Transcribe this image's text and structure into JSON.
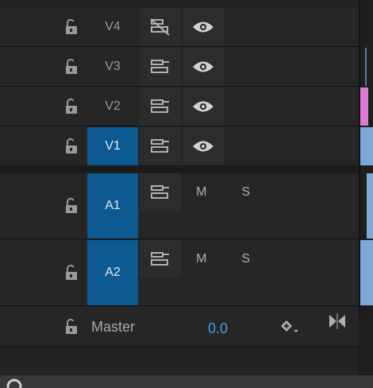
{
  "video_tracks": [
    {
      "label": "V4",
      "active": false,
      "target_icon": "sync-lock-off-icon",
      "visibility_icon": "eye-icon"
    },
    {
      "label": "V3",
      "active": false,
      "target_icon": "sync-lock-icon",
      "visibility_icon": "eye-icon"
    },
    {
      "label": "V2",
      "active": false,
      "target_icon": "sync-lock-icon",
      "visibility_icon": "eye-icon"
    },
    {
      "label": "V1",
      "active": true,
      "target_icon": "sync-lock-icon",
      "visibility_icon": "eye-icon"
    }
  ],
  "audio_tracks": [
    {
      "label": "A1",
      "active": true,
      "mute": "M",
      "solo": "S"
    },
    {
      "label": "A2",
      "active": true,
      "mute": "M",
      "solo": "S"
    }
  ],
  "master": {
    "label": "Master",
    "value": "0.0"
  },
  "colors": {
    "active_track": "#0d5a93",
    "value_text": "#3f9be8",
    "clip_video": "#7fa7d8",
    "clip_pink": "#e07ad6"
  }
}
